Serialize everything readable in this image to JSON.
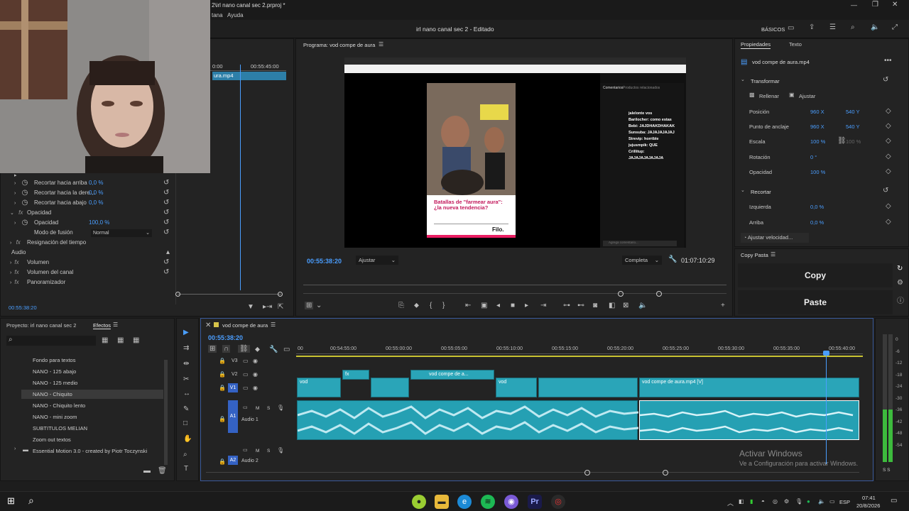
{
  "window": {
    "title": "2\\irl nano canal sec 2.prproj *",
    "minimize": "—",
    "maximize": "❐",
    "close": "✕"
  },
  "menu": [
    {
      "label": "tana"
    },
    {
      "label": "Ayuda"
    }
  ],
  "appbar": {
    "project_title": "irl nano canal sec 2 - Editado",
    "workspace": "BÁSICOS"
  },
  "source_mini": {
    "tc_left": "0:00",
    "tc_right": "00:55:45:00",
    "clip_label": "ura.mp4"
  },
  "effect_controls": {
    "rows": [
      {
        "label": "Recortar hacia arriba",
        "value": "0,0 %"
      },
      {
        "label": "Recortar hacia la dere...",
        "value": "0,0 %"
      },
      {
        "label": "Recortar hacia abajo",
        "value": "0,0 %"
      }
    ],
    "opacity_section": "Opacidad",
    "opacity_label": "Opacidad",
    "opacity_value": "100,0 %",
    "blend_label": "Modo de fusión",
    "blend_value": "Normal",
    "time_remap": "Resignación del tiempo",
    "audio_header": "Audio",
    "audio_rows": [
      {
        "label": "Volumen"
      },
      {
        "label": "Volumen del canal"
      },
      {
        "label": "Panoramizador"
      }
    ],
    "timecode": "00:55:38:20"
  },
  "program": {
    "header": "Programa: vod compe de aura",
    "timecode": "00:55:38:20",
    "fit": "Ajustar",
    "quality": "Completa",
    "duration": "01:07:10:29",
    "video": {
      "caption_title": "Batallas de \"farmear aura\": ¿la nueva tendencia?",
      "brand": "Filo.",
      "chat_tabs": [
        "Comentarios",
        "Productos relacionados"
      ],
      "chat_overlay": [
        "jalelonte vos",
        "Barilocher: como estas",
        "Bebi: JAJDHAKDHAKAK",
        "Sunsuba: JAJAJAJAJAJ",
        "Strevip: horrible",
        "jujusmpik: QUE",
        "Crillitup:",
        "JAJAJAJAJAJAJA"
      ],
      "comment_placeholder": "Agrega comentario..."
    }
  },
  "properties": {
    "tabs": [
      {
        "label": "Propiedades"
      },
      {
        "label": "Texto"
      }
    ],
    "clip_name": "vod compe de aura.mp4",
    "transform_header": "Transformar",
    "fill_label": "Rellenar",
    "fit_label": "Ajustar",
    "position": {
      "label": "Posición",
      "x": "960 X",
      "y": "540 Y"
    },
    "anchor": {
      "label": "Punto de anclaje",
      "x": "960 X",
      "y": "540 Y"
    },
    "scale": {
      "label": "Escala",
      "value": "100 %",
      "value2": "100 %"
    },
    "rotation": {
      "label": "Rotación",
      "value": "0 °"
    },
    "opacity": {
      "label": "Opacidad",
      "value": "100 %"
    },
    "crop_header": "Recortar",
    "left": {
      "label": "Izquierda",
      "value": "0,0 %"
    },
    "top": {
      "label": "Arriba",
      "value": "0,0 %"
    },
    "speed_btn": "Ajustar velocidad..."
  },
  "copypaste": {
    "title": "Copy Pasta",
    "copy": "Copy",
    "paste": "Paste"
  },
  "project": {
    "tabs": [
      {
        "label": "Proyecto: irl nano canal sec 2"
      },
      {
        "label": "Efectos"
      }
    ],
    "items": [
      {
        "label": "Fondo para textos"
      },
      {
        "label": "NANO - 125 abajo"
      },
      {
        "label": "NANO - 125 medio"
      },
      {
        "label": "NANO - Chiquito"
      },
      {
        "label": "NANO - Chiquito lento"
      },
      {
        "label": "NANO - mini zoom"
      },
      {
        "label": "SUBTITULOS MELIAN"
      },
      {
        "label": "Zoom out textos"
      },
      {
        "label": "Essential Motion 3.0 - created by Piotr Toczynski"
      }
    ]
  },
  "timeline": {
    "sequence": "vod compe de aura",
    "timecode": "00:55:38:20",
    "ticks": [
      "00",
      "00:54:55:00",
      "00:55:00:00",
      "00:55:05:00",
      "00:55:10:00",
      "00:55:15:00",
      "00:55:20:00",
      "00:55:25:00",
      "00:55:30:00",
      "00:55:35:00",
      "00:55:40:00"
    ],
    "tracks": {
      "v3": "V3",
      "v2": "V2",
      "v1": "V1",
      "a1": "A1",
      "a1_name": "Audio 1",
      "a2": "A2",
      "a2_name": "Audio 2"
    },
    "clips": {
      "v1_a": "vod",
      "v2_a": "vod compe de a...",
      "v1_b": "vod",
      "v1_main": "vod compe de aura.mp4 [V]"
    },
    "fx": "fx",
    "watermark_title": "Activar Windows",
    "watermark_sub": "Ve a Configuración para activar Windows.",
    "meter_scale": [
      "0",
      "-6",
      "-12",
      "-18",
      "-24",
      "-30",
      "-36",
      "-42",
      "-48",
      "-54"
    ],
    "meter_bottom": "S S"
  },
  "taskbar": {
    "lang": "ESP",
    "time": "07:41",
    "date": "20/8/2026"
  }
}
